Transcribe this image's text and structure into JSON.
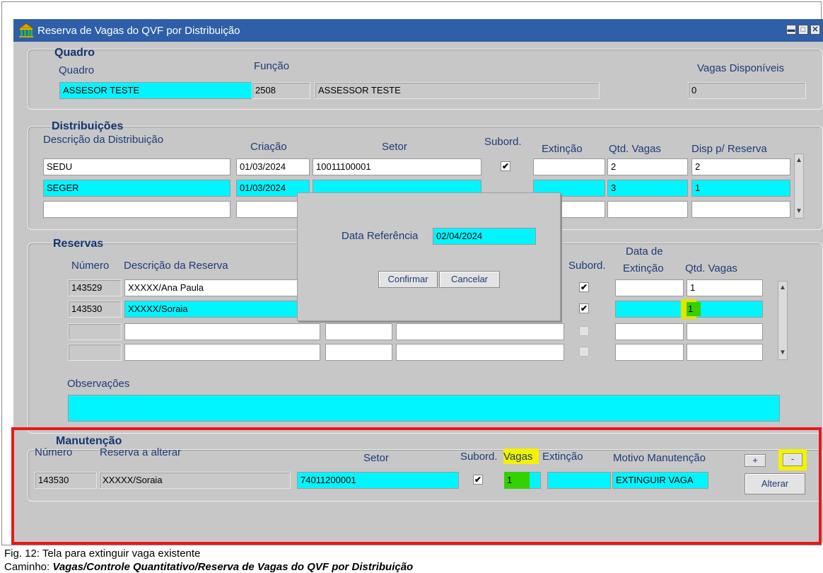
{
  "window": {
    "title": "Reserva de Vagas do QVF por Distribuição",
    "min_glyph": "▬",
    "max_glyph": "□",
    "close_glyph": "✕"
  },
  "quadro": {
    "header": "Quadro",
    "label_quadro": "Quadro",
    "label_funcao": "Função",
    "label_vagas": "Vagas Disponíveis",
    "quadro_value": "ASSESOR TESTE",
    "funcao_code": "2508",
    "funcao_desc": "ASSESSOR TESTE",
    "vagas_value": "0"
  },
  "distribuicoes": {
    "header": "Distribuições",
    "columns": [
      "Descrição da Distribuição",
      "Criação",
      "Setor",
      "Subord.",
      "Extinção",
      "Qtd. Vagas",
      "Disp p/ Reserva"
    ],
    "rows": [
      {
        "descricao": "SEDU",
        "criacao": "01/03/2024",
        "setor": "10011100001",
        "subord": true,
        "extincao": "",
        "qtd": "2",
        "disp": "2"
      },
      {
        "descricao": "SEGER",
        "criacao": "01/03/2024",
        "setor": "",
        "subord": true,
        "extincao": "",
        "qtd": "3",
        "disp": "1"
      },
      {
        "descricao": "",
        "criacao": "",
        "setor": "",
        "subord": false,
        "extincao": "",
        "qtd": "",
        "disp": ""
      }
    ]
  },
  "reservas": {
    "header": "Reservas",
    "columns": {
      "numero": "Número",
      "descricao": "Descrição da Reserva",
      "subord": "Subord.",
      "data_extincao_1": "Data de",
      "data_extincao_2": "Extinção",
      "qtd": "Qtd. Vagas"
    },
    "rows": [
      {
        "numero": "143529",
        "descricao": "XXXXX/Ana Paula",
        "subord": true,
        "qtd": "1"
      },
      {
        "numero": "143530",
        "descricao": "XXXXX/Soraia",
        "subord": true,
        "qtd": "1"
      },
      {
        "numero": "",
        "descricao": "",
        "subord": false,
        "qtd": ""
      },
      {
        "numero": "",
        "descricao": "",
        "subord": false,
        "qtd": ""
      }
    ],
    "observacoes_label": "Observações",
    "observacoes_value": ""
  },
  "dialog": {
    "label": "Data Referência",
    "value": "02/04/2024",
    "confirm": "Confirmar",
    "cancel": "Cancelar"
  },
  "manutencao": {
    "header": "Manutenção",
    "labels": {
      "numero": "Número",
      "reserva": "Reserva a alterar",
      "setor": "Setor",
      "subord": "Subord.",
      "vagas": "Vagas",
      "extincao": "Extinção",
      "motivo": "Motivo Manutenção"
    },
    "numero": "143530",
    "reserva": "XXXXX/Soraia",
    "setor": "74011200001",
    "subord": true,
    "vagas": "1",
    "extincao": "",
    "motivo": "EXTINGUIR VAGA",
    "plus_label": "+",
    "minus_label": "-",
    "alterar_label": "Alterar"
  },
  "caption": {
    "fig": "Fig. 12: Tela para extinguir vaga existente",
    "path_prefix": "Caminho: ",
    "path": "Vagas/Controle Quantitativo/Reserva de Vagas do QVF por Distribuição"
  },
  "colors": {
    "field_cyan": "#00f5ff",
    "title_blue": "#2e5fa8",
    "highlight_red": "#e8171c",
    "highlight_yellow": "#f3f300",
    "highlight_green": "#35d000"
  }
}
